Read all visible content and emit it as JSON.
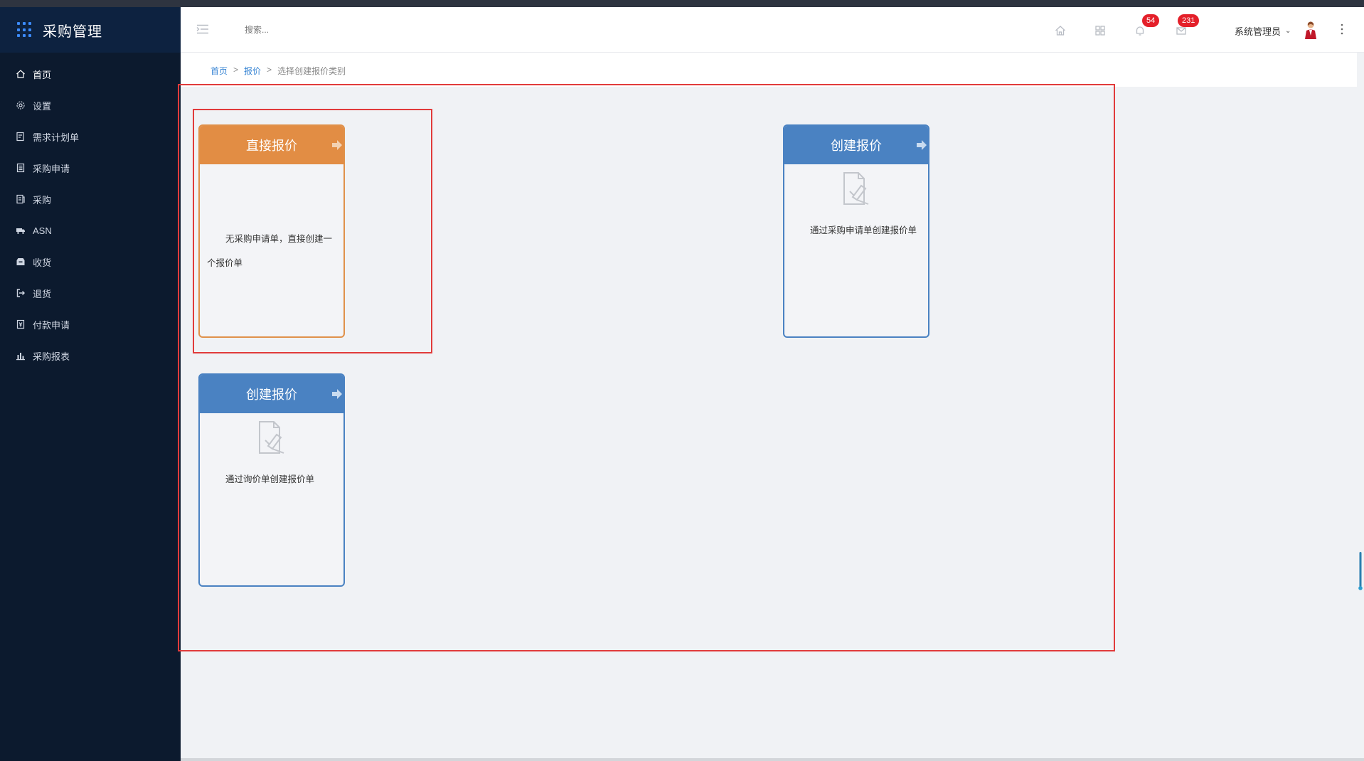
{
  "app": {
    "title": "采购管理"
  },
  "sidebar": {
    "items": [
      {
        "label": "首页",
        "icon": "home-icon"
      },
      {
        "label": "设置",
        "icon": "gear-icon"
      },
      {
        "label": "需求计划单",
        "icon": "edit-doc-icon"
      },
      {
        "label": "采购申请",
        "icon": "doc-list-icon"
      },
      {
        "label": "采购",
        "icon": "doc-icon"
      },
      {
        "label": "ASN",
        "icon": "truck-icon"
      },
      {
        "label": "收货",
        "icon": "inbox-icon"
      },
      {
        "label": "退货",
        "icon": "return-icon"
      },
      {
        "label": "付款申请",
        "icon": "payment-doc-icon"
      },
      {
        "label": "采购报表",
        "icon": "bar-chart-icon"
      }
    ]
  },
  "header": {
    "search_placeholder": "搜索...",
    "notifications_count": "54",
    "messages_count": "231",
    "user_name": "系统管理员"
  },
  "breadcrumb": {
    "home": "首页",
    "sep": ">",
    "section": "报价",
    "current": "选择创建报价类别"
  },
  "cards": {
    "direct": {
      "title": "直接报价",
      "desc": "无采购申请单，直接创建一个报价单"
    },
    "from_request": {
      "title": "创建报价",
      "desc": "通过采购申请单创建报价单"
    },
    "from_inquiry": {
      "title": "创建报价",
      "desc": "通过询价单创建报价单"
    }
  },
  "colors": {
    "sidebar_bg": "#0c1a2e",
    "accent_blue": "#4a82c2",
    "accent_orange": "#e28d44",
    "badge_red": "#e4202a",
    "highlight_red": "#e13b3b"
  }
}
